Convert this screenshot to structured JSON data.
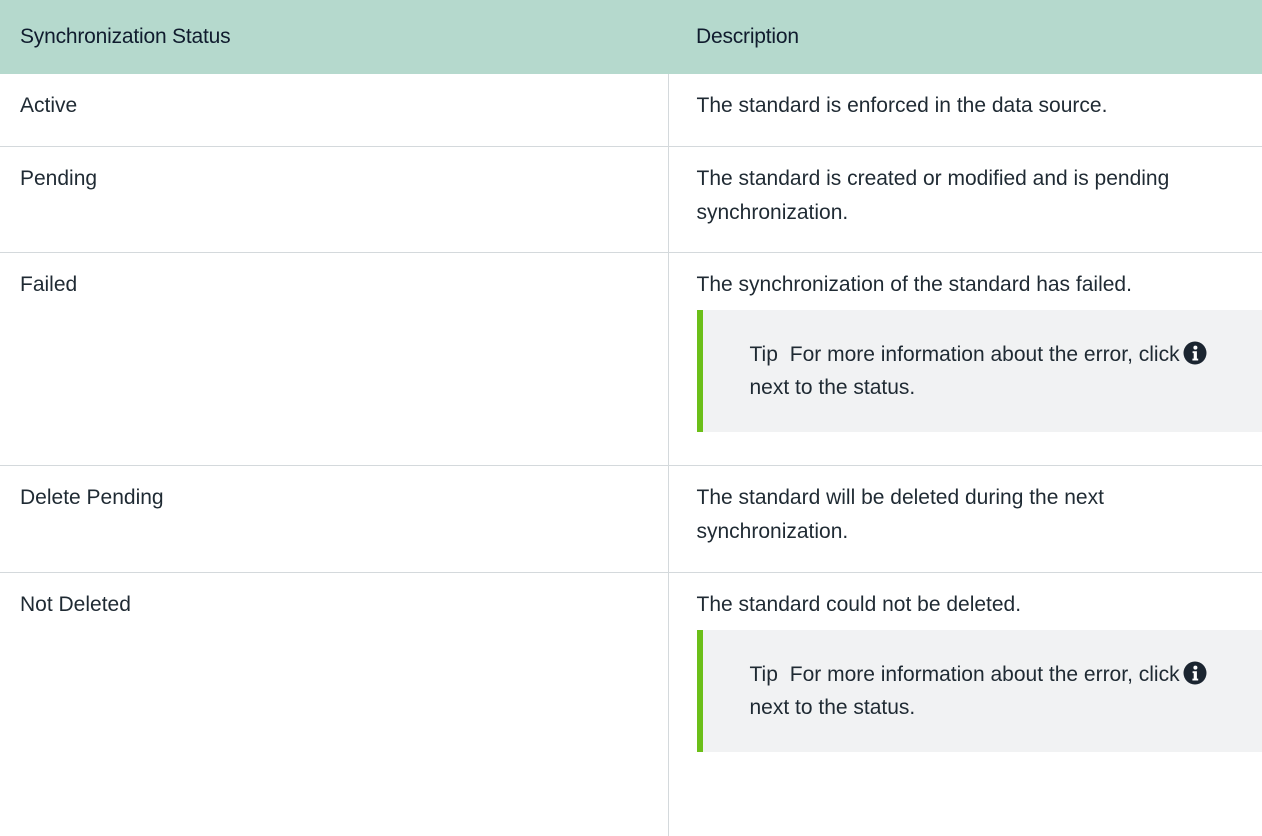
{
  "table": {
    "headers": {
      "status": "Synchronization Status",
      "description": "Description"
    },
    "rows": [
      {
        "status": "Active",
        "description": "The standard is enforced in the data source."
      },
      {
        "status": "Pending",
        "description": "The standard is created or modified and is pending synchronization."
      },
      {
        "status": "Failed",
        "description": "The synchronization of the standard has failed.",
        "tip": {
          "label": "Tip",
          "text_before_icon": "For more information about the error, click",
          "icon": "info-circle-icon",
          "text_after_icon": "next to the status."
        }
      },
      {
        "status": "Delete Pending",
        "description": "The standard will be deleted during the next synchronization."
      },
      {
        "status": "Not Deleted",
        "description": "The standard could not be deleted.",
        "tip": {
          "label": "Tip",
          "text_before_icon": "For more information about the error, click",
          "icon": "info-circle-icon",
          "text_after_icon": "next to the status."
        }
      }
    ]
  },
  "colors": {
    "header_background": "#b5d9cd",
    "tip_background": "#f1f2f3",
    "tip_accent": "#6bbf18",
    "grid_line": "#d4d9dc"
  }
}
